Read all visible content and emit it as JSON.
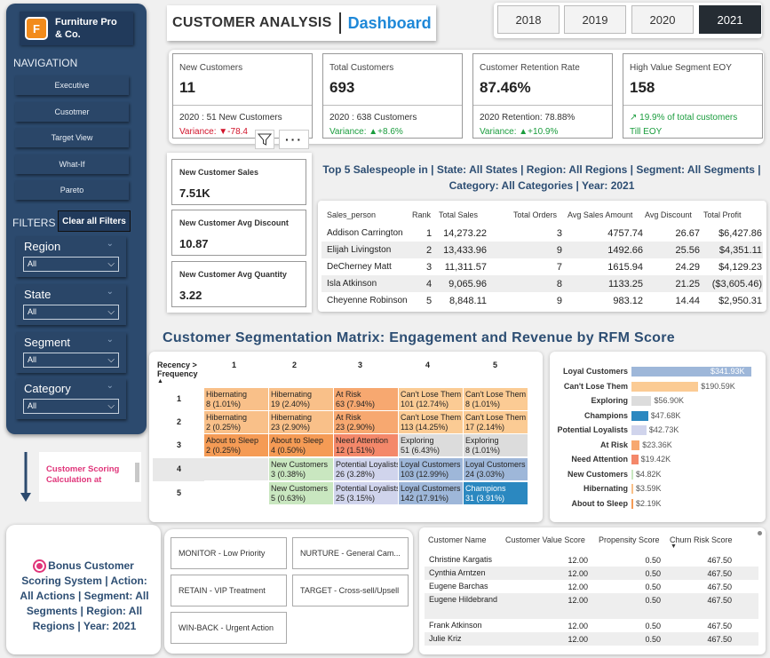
{
  "sidebar": {
    "logo_letter": "F",
    "logo_text": "Furniture Pro & Co.",
    "nav_title": "NAVIGATION",
    "nav_items": [
      "Executive",
      "Cusotmer",
      "Target View",
      "What-If",
      "Pareto"
    ],
    "filters_title": "FILTERS",
    "clear_label": "Clear all Filters",
    "filters": [
      {
        "label": "Region",
        "value": "All"
      },
      {
        "label": "State",
        "value": "All"
      },
      {
        "label": "Segment",
        "value": "All"
      },
      {
        "label": "Category",
        "value": "All"
      }
    ]
  },
  "scoring_note": "Customer Scoring Calculation at",
  "header": {
    "title": "CUSTOMER ANALYSIS",
    "subtitle": "Dashboard",
    "years": [
      "2018",
      "2019",
      "2020",
      "2021"
    ],
    "selected_year": "2021"
  },
  "kpis": [
    {
      "label": "New Customers",
      "value": "11",
      "sub1": "2020 : 51 New Customers",
      "sub2": "Variance: ▼-78.4",
      "sub2_color": "red"
    },
    {
      "label": "Total Customers",
      "value": "693",
      "sub1": "2020 : 638 Customers",
      "sub2": "Variance: ▲+8.6%",
      "sub2_color": "green"
    },
    {
      "label": "Customer Retention Rate",
      "value": "87.46%",
      "sub1": "2020 Retention: 78.88%",
      "sub2": "Variance: ▲+10.9%",
      "sub2_color": "green"
    },
    {
      "label": "High Value Segment EOY",
      "value": "158",
      "sub1": "↗ 19.9% of total customers",
      "sub2": "Till EOY",
      "sub2_color": "green",
      "sub1_color": "green"
    }
  ],
  "small_metrics": [
    {
      "label": "New Customer Sales",
      "value": "7.51K"
    },
    {
      "label": "New Customer Avg Discount",
      "value": "10.87"
    },
    {
      "label": "New Customer Avg Quantity",
      "value": "3.22"
    }
  ],
  "salespeople": {
    "title": "Top 5 Salespeople in | State: All States | Region: All Regions | Segment: All Segments | Category: All Categories | Year: 2021",
    "headers": [
      "Sales_person",
      "Rank",
      "Total Sales",
      "Total Orders",
      "Avg Sales Amount",
      "Avg Discount",
      "Total Profit"
    ],
    "rows": [
      [
        "Addison Carrington",
        "1",
        "14,273.22",
        "3",
        "4757.74",
        "26.67",
        "$6,427.86"
      ],
      [
        "Elijah Livingston",
        "2",
        "13,433.96",
        "9",
        "1492.66",
        "25.56",
        "$4,351.11"
      ],
      [
        "DeCherney Matt",
        "3",
        "11,311.57",
        "7",
        "1615.94",
        "24.29",
        "$4,129.23"
      ],
      [
        "Isla Atkinson",
        "4",
        "9,065.96",
        "8",
        "1133.25",
        "21.25",
        "($3,605.46)"
      ],
      [
        "Cheyenne Robinson",
        "5",
        "8,848.11",
        "9",
        "983.12",
        "14.44",
        "$2,950.31"
      ]
    ]
  },
  "segmentation": {
    "title": "Customer Segmentation Matrix:  Engagement and Revenue by RFM Score",
    "corner_label": "Recency > Frequency",
    "col_labels": [
      "1",
      "2",
      "3",
      "4",
      "5"
    ],
    "row_labels": [
      "1",
      "2",
      "3",
      "4",
      "5"
    ],
    "cells": [
      [
        {
          "t": "Hibernating",
          "v": "8 (1.01%)",
          "c": "#f9c089"
        },
        {
          "t": "Hibernating",
          "v": "19 (2.40%)",
          "c": "#f9c089"
        },
        {
          "t": "At Risk",
          "v": "63 (7.94%)",
          "c": "#f7a870"
        },
        {
          "t": "Can't Lose Them",
          "v": "101 (12.74%)",
          "c": "#fbcb94"
        },
        {
          "t": "Can't Lose Them",
          "v": "8 (1.01%)",
          "c": "#fbcb94"
        }
      ],
      [
        {
          "t": "Hibernating",
          "v": "2 (0.25%)",
          "c": "#f9c089"
        },
        {
          "t": "Hibernating",
          "v": "23 (2.90%)",
          "c": "#f9c089"
        },
        {
          "t": "At Risk",
          "v": "23 (2.90%)",
          "c": "#f7a870"
        },
        {
          "t": "Can't Lose Them",
          "v": "113 (14.25%)",
          "c": "#fbcb94"
        },
        {
          "t": "Can't Lose Them",
          "v": "17 (2.14%)",
          "c": "#fbcb94"
        }
      ],
      [
        {
          "t": "About to Sleep",
          "v": "2 (0.25%)",
          "c": "#f59b55"
        },
        {
          "t": "About to Sleep",
          "v": "4 (0.50%)",
          "c": "#f59b55"
        },
        {
          "t": "Need Attention",
          "v": "12 (1.51%)",
          "c": "#f4886a"
        },
        {
          "t": "Exploring",
          "v": "51 (6.43%)",
          "c": "#dcdcdc"
        },
        {
          "t": "Exploring",
          "v": "8 (1.01%)",
          "c": "#dcdcdc"
        }
      ],
      [
        {
          "t": "",
          "v": "",
          "c": "#e8e8e8"
        },
        {
          "t": "New Customers",
          "v": "3 (0.38%)",
          "c": "#c9e7c0"
        },
        {
          "t": "Potential Loyalists",
          "v": "26 (3.28%)",
          "c": "#d0d4ec"
        },
        {
          "t": "Loyal Customers",
          "v": "103 (12.99%)",
          "c": "#9eb7d9"
        },
        {
          "t": "Loyal Customers",
          "v": "24 (3.03%)",
          "c": "#9eb7d9"
        }
      ],
      [
        {
          "t": "",
          "v": "",
          "c": "#ffffff"
        },
        {
          "t": "New Customers",
          "v": "5 (0.63%)",
          "c": "#c9e7c0"
        },
        {
          "t": "Potential Loyalists",
          "v": "25 (3.15%)",
          "c": "#d0d4ec"
        },
        {
          "t": "Loyal Customers",
          "v": "142 (17.91%)",
          "c": "#9eb7d9"
        },
        {
          "t": "Champions",
          "v": "31 (3.91%)",
          "c": "#2b88c0"
        }
      ]
    ]
  },
  "chart_data": {
    "type": "bar",
    "orientation": "horizontal",
    "categories": [
      "Loyal Customers",
      "Can't Lose Them",
      "Exploring",
      "Champions",
      "Potential Loyalists",
      "At Risk",
      "Need Attention",
      "New Customers",
      "Hibernating",
      "About to Sleep"
    ],
    "values": [
      341.93,
      190.59,
      56.9,
      47.68,
      42.73,
      23.36,
      19.42,
      4.82,
      3.59,
      2.19
    ],
    "value_labels": [
      "$341.93K",
      "$190.59K",
      "$56.90K",
      "$47.68K",
      "$42.73K",
      "$23.36K",
      "$19.42K",
      "$4.82K",
      "$3.59K",
      "$2.19K"
    ],
    "colors": [
      "#9eb7d9",
      "#fbcb94",
      "#dcdcdc",
      "#2b88c0",
      "#d0d4ec",
      "#f7a870",
      "#f4886a",
      "#c9e7c0",
      "#f9c089",
      "#f59b55"
    ],
    "xlim": [
      0,
      341.93
    ]
  },
  "bonus": {
    "text": "Bonus Customer Scoring System | Action: All Actions | Segment: All Segments | Region: All Regions | Year: 2021"
  },
  "actions": [
    "MONITOR - Low Priority",
    "NURTURE - General Cam...",
    "RETAIN - VIP Treatment",
    "TARGET - Cross-sell/Upsell",
    "WIN-BACK - Urgent Action"
  ],
  "customers": {
    "headers": [
      "Customer Name",
      "Customer Value Score",
      "Propensity Score",
      "Churn Risk Score"
    ],
    "rows": [
      [
        "Christine Kargatis",
        "12.00",
        "0.50",
        "467.50"
      ],
      [
        "Cynthia Arntzen",
        "12.00",
        "0.50",
        "467.50"
      ],
      [
        "Eugene Barchas",
        "12.00",
        "0.50",
        "467.50"
      ],
      [
        "Eugene Hildebrand",
        "12.00",
        "0.50",
        "467.50"
      ],
      [
        "Frank Atkinson",
        "12.00",
        "0.50",
        "467.50"
      ],
      [
        "Julie Kriz",
        "12.00",
        "0.50",
        "467.50"
      ]
    ]
  }
}
